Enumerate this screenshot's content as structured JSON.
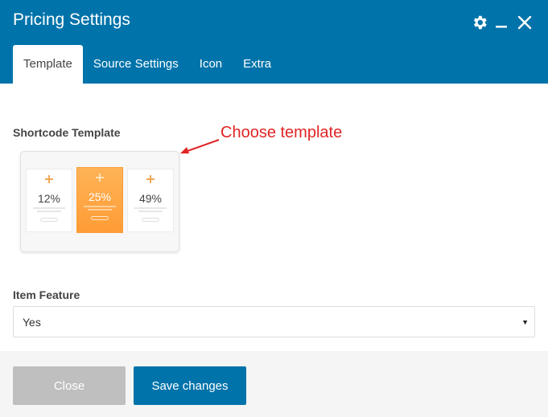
{
  "window": {
    "title": "Pricing Settings",
    "icons": {
      "settings": "gear-icon",
      "minimize": "minimize-icon",
      "close": "close-icon"
    },
    "accent_color": "#0073aa"
  },
  "tabs": [
    {
      "label": "Template",
      "active": true
    },
    {
      "label": "Source Settings",
      "active": false
    },
    {
      "label": "Icon",
      "active": false
    },
    {
      "label": "Extra",
      "active": false
    }
  ],
  "shortcode_template": {
    "label": "Shortcode Template",
    "annotation": "Choose template",
    "annotation_color": "#e02424",
    "preview": {
      "cards": [
        {
          "name": "",
          "percent": "12%",
          "featured": false
        },
        {
          "name": "",
          "percent": "25%",
          "featured": true
        },
        {
          "name": "",
          "percent": "49%",
          "featured": false
        }
      ]
    }
  },
  "item_feature": {
    "label": "Item Feature",
    "selected": "Yes"
  },
  "footer": {
    "close_label": "Close",
    "save_label": "Save changes"
  }
}
